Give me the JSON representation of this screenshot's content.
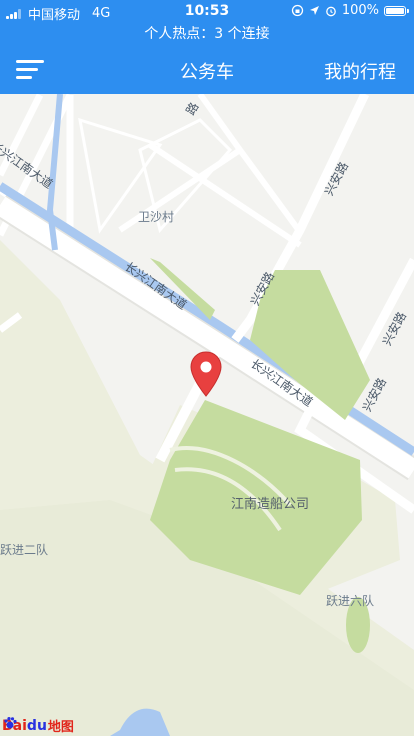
{
  "status_bar": {
    "carrier": "中国移动",
    "network": "4G",
    "time": "10:53",
    "battery_percent": "100%",
    "hotspot_text": "个人热点：3 个连接"
  },
  "navbar": {
    "title": "公务车",
    "right_label": "我的行程"
  },
  "map": {
    "labels": {
      "weishacun": "卫沙村",
      "jiangnan_shipyard": "江南造船公司",
      "yuejin_2": "跃进二队",
      "yuejin_6": "跃进六队",
      "road_changxing_1": "长兴江南大道",
      "road_changxing_2": "长兴江南大道",
      "road_changxing_3": "长兴江南大道",
      "road_xingan_1": "兴安路",
      "road_xingan_2": "兴安路",
      "road_xingan_3": "兴安路",
      "road_xingan_4": "兴安路",
      "road_top": "路"
    },
    "watermark": {
      "part1": "Bai",
      "part2": "du",
      "part3": "地图"
    }
  },
  "colors": {
    "brand_blue": "#2d8ef0",
    "green_area": "#c5dc9f",
    "water": "#a9c8f0",
    "farmland": "#eceedd",
    "pin_red": "#e8403f"
  }
}
